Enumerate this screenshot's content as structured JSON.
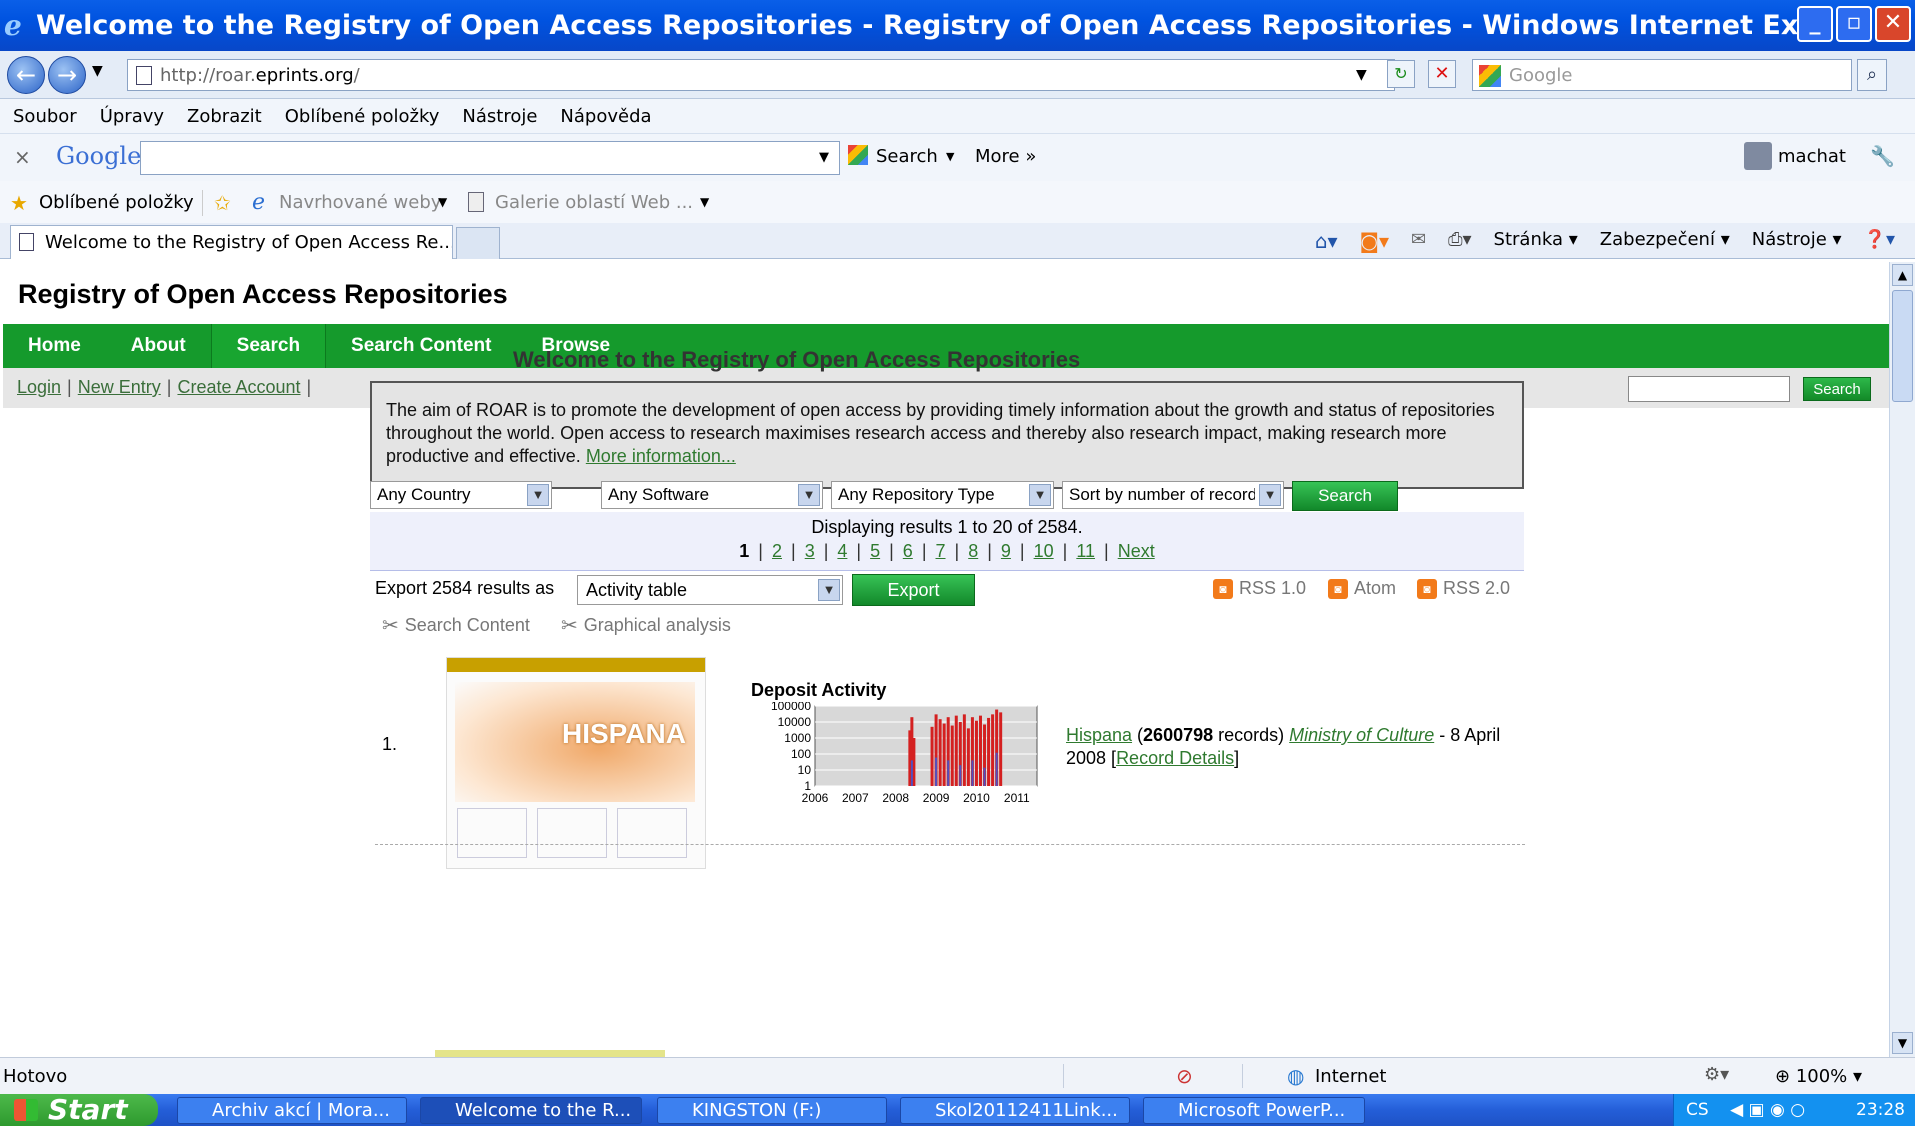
{
  "window": {
    "title": "Welcome to the Registry of Open Access Repositories - Registry of Open Access Repositories - Windows Internet Explorer",
    "min": "_",
    "max": "▫",
    "close": "✕"
  },
  "address": {
    "back": "←",
    "forward": "→",
    "url_prefix": "http://roar.",
    "url_domain": "eprints.org",
    "url_suffix": "/",
    "search_placeholder": "Google"
  },
  "menu": [
    "Soubor",
    "Úpravy",
    "Zobrazit",
    "Oblíbené položky",
    "Nástroje",
    "Nápověda"
  ],
  "google_toolbar": {
    "close": "×",
    "logo": "Google",
    "search_label": "Search",
    "more_label": "More »",
    "user": "machat"
  },
  "favorites": {
    "label": "Oblíbené položky",
    "suggested": "Navrhované weby",
    "gallery": "Galerie oblastí Web ..."
  },
  "tab": {
    "title": "Welcome to the Registry of Open Access Re..."
  },
  "commandbar": [
    "Stránka",
    "Zabezpečení",
    "Nástroje"
  ],
  "site": {
    "title": "Registry of Open Access Repositories",
    "nav": [
      "Home",
      "About",
      "Search",
      "Search Content",
      "Browse"
    ],
    "subnav": [
      "Login",
      "New Entry",
      "Create Account"
    ],
    "quick_search_button": "Search",
    "heading": "Welcome to the Registry of Open Access Repositories",
    "aim_text": "The aim of ROAR is to promote the development of open access by providing timely information about the growth and status of repositories throughout the world. Open access to research maximises research access and thereby also research impact, making research more productive and effective.",
    "aim_link": "More information...",
    "filters": {
      "country": "Any Country",
      "software": "Any Software",
      "type": "Any Repository Type",
      "sort": "Sort by number of records"
    },
    "search_button": "Search",
    "results_text": "Displaying results 1 to 20 of 2584.",
    "pager": {
      "current": "1",
      "pages": [
        "2",
        "3",
        "4",
        "5",
        "6",
        "7",
        "8",
        "9",
        "10",
        "11"
      ],
      "next": "Next"
    },
    "export_label": "Export 2584 results as",
    "export_format": "Activity table",
    "export_button": "Export",
    "feeds": [
      "RSS 1.0",
      "Atom",
      "RSS 2.0"
    ],
    "tools": [
      "Search Content",
      "Graphical analysis"
    ],
    "entry": {
      "rank": "1.",
      "thumb_text": "HISPANA",
      "chart_title": "Deposit Activity",
      "name": "Hispana",
      "records": "2600798",
      "records_word": "records)",
      "org": "Ministry of Culture",
      "date": "- 8 April 2008",
      "details": "Record Details"
    }
  },
  "chart_data": {
    "type": "bar",
    "title": "Deposit Activity",
    "yscale": "log",
    "yticks": [
      "100000",
      "10000",
      "1000",
      "100",
      "10",
      "1"
    ],
    "xticks": [
      "2006",
      "2007",
      "2008",
      "2009",
      "2010",
      "2011"
    ],
    "ylim": [
      1,
      100000
    ],
    "series_color": "#d42020",
    "secondary_color": "#5050c0",
    "bars": [
      {
        "x": 2008.35,
        "value": 3000
      },
      {
        "x": 2008.4,
        "value": 20000
      },
      {
        "x": 2008.45,
        "value": 1000
      },
      {
        "x": 2008.9,
        "value": 5000
      },
      {
        "x": 2009.0,
        "value": 30000
      },
      {
        "x": 2009.1,
        "value": 15000
      },
      {
        "x": 2009.2,
        "value": 8000
      },
      {
        "x": 2009.3,
        "value": 20000
      },
      {
        "x": 2009.4,
        "value": 6000
      },
      {
        "x": 2009.5,
        "value": 25000
      },
      {
        "x": 2009.6,
        "value": 10000
      },
      {
        "x": 2009.7,
        "value": 30000
      },
      {
        "x": 2009.8,
        "value": 4000
      },
      {
        "x": 2009.9,
        "value": 20000
      },
      {
        "x": 2010.0,
        "value": 12000
      },
      {
        "x": 2010.1,
        "value": 25000
      },
      {
        "x": 2010.2,
        "value": 7000
      },
      {
        "x": 2010.3,
        "value": 18000
      },
      {
        "x": 2010.4,
        "value": 30000
      },
      {
        "x": 2010.5,
        "value": 60000
      },
      {
        "x": 2010.6,
        "value": 40000
      }
    ]
  },
  "status": {
    "left": "Hotovo",
    "zone": "Internet",
    "zoom": "100%"
  },
  "taskbar": {
    "start": "Start",
    "items": [
      "Archiv akcí | Mora...",
      "Welcome to the R...",
      "KINGSTON (F:)",
      "Skol20112411Link...",
      "Microsoft PowerP..."
    ],
    "lang": "CS",
    "clock": "23:28"
  }
}
